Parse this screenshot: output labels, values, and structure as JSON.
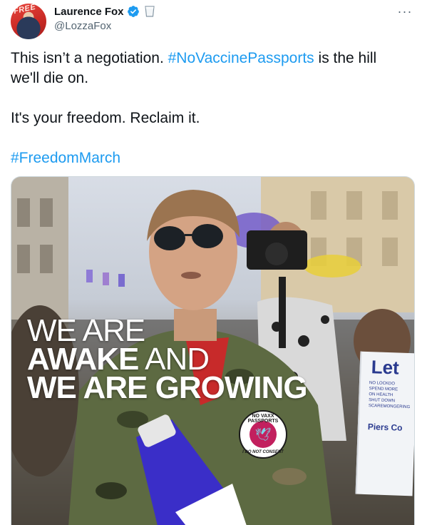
{
  "author": {
    "display_name": "Laurence Fox",
    "handle": "@LozzaFox",
    "avatar_text": "FREE",
    "verified": true
  },
  "menu": {
    "more_label": "···"
  },
  "tweet": {
    "line1_prefix": "This isn’t a negotiation. ",
    "line1_hashtag": "#NoVaccinePassports",
    "line1_suffix": " is the hill",
    "line2": "we'll die on.",
    "line3": "It's your freedom. Reclaim it.",
    "hashtag2": "#FreedomMarch"
  },
  "media": {
    "overlay_line1": "WE ARE",
    "overlay_line2_bold": "AWAKE",
    "overlay_line2_thin": " AND",
    "overlay_line3": "WE ARE GROWING",
    "badge_top": "NO VAXX PASSPORTS",
    "badge_bottom": "I DO NOT CONSENT",
    "sign_title": "Let",
    "sign_lines": [
      "NO LOCKDO",
      "SPEND MORE",
      "ON HEALTH",
      "SHUT DOWN",
      "SCAREMONGERING"
    ],
    "sign_name": "Piers Co"
  },
  "colors": {
    "link": "#1d9bf0",
    "text": "#0f1419",
    "secondary": "#536471",
    "verified": "#1d9bf0"
  }
}
